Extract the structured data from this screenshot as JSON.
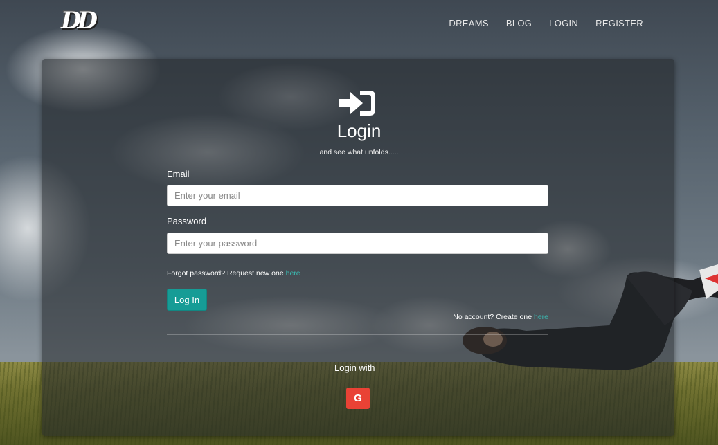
{
  "brand": {
    "logo_text": "DD"
  },
  "nav": {
    "items": [
      {
        "label": "DREAMS"
      },
      {
        "label": "BLOG"
      },
      {
        "label": "LOGIN"
      },
      {
        "label": "REGISTER"
      }
    ]
  },
  "login": {
    "icon": "sign-in-icon",
    "title": "Login",
    "subtitle": "and see what unfolds.....",
    "email_label": "Email",
    "email_placeholder": "Enter your email",
    "email_value": "",
    "password_label": "Password",
    "password_placeholder": "Enter your password",
    "password_value": "",
    "forgot_text": "Forgot password? Request new one ",
    "forgot_link": "here",
    "submit_label": "Log In",
    "no_account_text": "No account? Create one ",
    "no_account_link": "here",
    "login_with": "Login with",
    "google_label": "G",
    "google_icon": "google-icon"
  },
  "colors": {
    "accent": "#169c96",
    "link": "#3bb8b0",
    "google": "#e94235"
  }
}
